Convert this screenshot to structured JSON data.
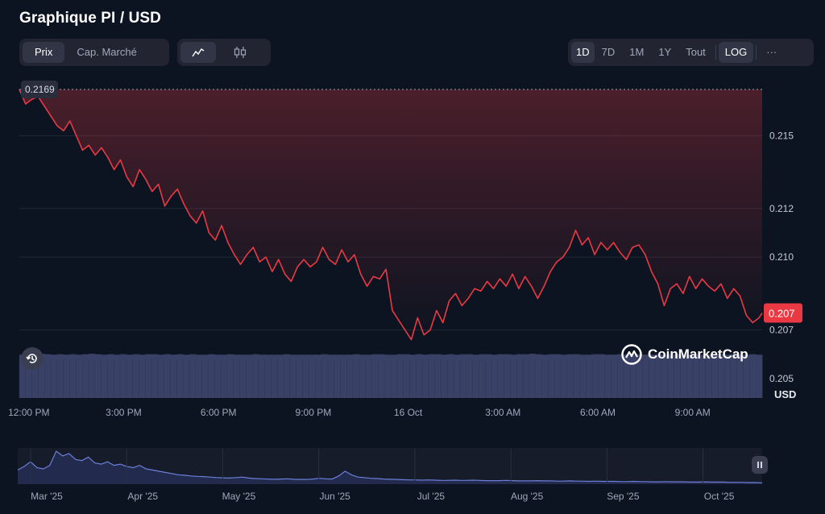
{
  "title": "Graphique PI / USD",
  "view_tabs": [
    {
      "label": "Prix",
      "active": true
    },
    {
      "label": "Cap. Marché",
      "active": false
    }
  ],
  "chart_type_icons": [
    {
      "name": "line-chart-icon",
      "active": true
    },
    {
      "name": "candlestick-icon",
      "active": false
    }
  ],
  "ranges": [
    {
      "label": "1D",
      "active": true
    },
    {
      "label": "7D",
      "active": false
    },
    {
      "label": "1M",
      "active": false
    },
    {
      "label": "1Y",
      "active": false
    },
    {
      "label": "Tout",
      "active": false
    }
  ],
  "log_label": "LOG",
  "more_label": "···",
  "watermark": "CoinMarketCap",
  "currency_label": "USD",
  "history_icon": "history-icon",
  "pause_icon": "pause-icon",
  "colors": {
    "background": "#0d1421",
    "price_line": "#ea3943",
    "volume": "#3a4166",
    "navigator_line": "#6c7fd8"
  },
  "chart_data": [
    {
      "type": "line",
      "title": "Graphique PI / USD",
      "y_unit": "USD",
      "scale": "linear",
      "ylim": [
        0.2042,
        0.2172
      ],
      "yticks": [
        "0.205",
        "0.207",
        "0.210",
        "0.212",
        "0.215"
      ],
      "xticks": [
        "12:00 PM",
        "3:00 PM",
        "6:00 PM",
        "9:00 PM",
        "16 Oct",
        "3:00 AM",
        "6:00 AM",
        "9:00 AM"
      ],
      "x_range_hours": [
        11.7,
        35.2
      ],
      "open_marker": "0.2169",
      "last_price_label": "0.207",
      "grid": true,
      "series": [
        {
          "x": [
            11.7,
            11.9,
            12.1,
            12.3,
            12.5,
            12.7,
            12.9,
            13.1,
            13.3,
            13.5,
            13.7,
            13.9,
            14.1,
            14.3,
            14.5,
            14.7,
            14.9,
            15.1,
            15.3,
            15.5,
            15.7,
            15.9,
            16.1,
            16.3,
            16.5,
            16.7,
            16.9,
            17.1,
            17.3,
            17.5,
            17.7,
            17.9,
            18.1,
            18.3,
            18.5,
            18.7,
            18.9,
            19.1,
            19.3,
            19.5,
            19.7,
            19.9,
            20.1,
            20.3,
            20.5,
            20.7,
            20.9,
            21.1,
            21.3,
            21.5,
            21.7,
            21.9,
            22.1,
            22.3,
            22.5,
            22.7,
            22.9,
            23.1,
            23.3,
            23.5,
            23.7,
            23.9,
            24.1,
            24.3,
            24.5,
            24.7,
            24.9,
            25.1,
            25.3,
            25.5,
            25.7,
            25.9,
            26.1,
            26.3,
            26.5,
            26.7,
            26.9,
            27.1,
            27.3,
            27.5,
            27.7,
            27.9,
            28.1,
            28.3,
            28.5,
            28.7,
            28.9,
            29.1,
            29.3,
            29.5,
            29.7,
            29.9,
            30.1,
            30.3,
            30.5,
            30.7,
            30.9,
            31.1,
            31.3,
            31.5,
            31.7,
            31.9,
            32.1,
            32.3,
            32.5,
            32.7,
            32.9,
            33.1,
            33.3,
            33.5,
            33.7,
            33.9,
            34.1,
            34.3,
            34.5,
            34.7,
            34.9,
            35.1,
            35.2
          ],
          "values": [
            0.2169,
            0.2163,
            0.2165,
            0.2166,
            0.2162,
            0.2158,
            0.2154,
            0.2152,
            0.2156,
            0.215,
            0.2144,
            0.2146,
            0.2142,
            0.2145,
            0.2141,
            0.2136,
            0.214,
            0.2133,
            0.2129,
            0.2136,
            0.2132,
            0.2127,
            0.213,
            0.2121,
            0.2125,
            0.2128,
            0.2122,
            0.2117,
            0.2114,
            0.2119,
            0.211,
            0.2107,
            0.2113,
            0.2106,
            0.2101,
            0.2097,
            0.2101,
            0.2104,
            0.2098,
            0.21,
            0.2094,
            0.2099,
            0.2093,
            0.209,
            0.2096,
            0.2099,
            0.2096,
            0.2098,
            0.2104,
            0.2099,
            0.2097,
            0.2103,
            0.2098,
            0.2101,
            0.2093,
            0.2088,
            0.2092,
            0.2091,
            0.2095,
            0.2078,
            0.2074,
            0.207,
            0.2066,
            0.2075,
            0.2068,
            0.207,
            0.2078,
            0.2073,
            0.2082,
            0.2085,
            0.208,
            0.2083,
            0.2087,
            0.2086,
            0.209,
            0.2087,
            0.2091,
            0.2088,
            0.2093,
            0.2087,
            0.2092,
            0.2088,
            0.2083,
            0.2088,
            0.2094,
            0.2098,
            0.21,
            0.2104,
            0.2111,
            0.2105,
            0.2108,
            0.2101,
            0.2106,
            0.2103,
            0.2106,
            0.2102,
            0.2099,
            0.2104,
            0.2105,
            0.2101,
            0.2094,
            0.2089,
            0.208,
            0.2087,
            0.2089,
            0.2085,
            0.2092,
            0.2087,
            0.2091,
            0.2088,
            0.2086,
            0.2089,
            0.2083,
            0.2087,
            0.2084,
            0.2076,
            0.2073,
            0.2075,
            0.2077
          ]
        }
      ],
      "volume": {
        "type": "bar",
        "relative_heights": [
          0.96,
          0.97,
          0.96,
          0.98,
          0.97,
          0.96,
          0.97,
          0.96,
          0.97,
          0.96,
          0.97,
          0.98,
          0.97,
          0.96,
          0.97,
          0.96,
          0.97,
          0.96,
          0.97,
          0.96,
          0.97,
          0.97,
          0.96,
          0.97,
          0.96,
          0.97,
          0.96,
          0.97,
          0.96,
          0.96,
          0.97,
          0.96,
          0.96,
          0.97,
          0.96,
          0.96,
          0.96,
          0.97,
          0.96,
          0.96,
          0.96,
          0.96,
          0.97,
          0.96,
          0.96,
          0.96,
          0.96,
          0.96,
          0.97,
          0.96,
          0.96,
          0.96,
          0.96,
          0.97,
          0.96,
          0.96,
          0.97,
          0.97,
          0.96,
          0.96,
          0.97,
          0.97,
          0.96,
          0.97,
          0.96,
          0.97,
          0.97,
          0.96,
          0.97,
          0.96,
          0.97,
          0.97,
          0.96,
          0.97,
          0.97,
          0.96,
          0.97,
          0.97,
          0.96,
          0.97,
          0.97,
          0.98,
          0.97,
          0.96,
          0.97,
          0.97,
          0.96,
          0.97,
          0.97,
          0.96,
          0.96,
          0.97,
          0.97,
          0.96,
          0.96,
          0.97,
          0.96,
          0.96,
          0.97,
          0.96,
          0.96,
          0.97,
          0.96,
          0.96,
          0.97,
          0.96,
          0.96,
          0.97,
          0.96,
          0.96,
          0.97,
          0.96,
          0.96,
          0.97,
          0.96,
          0.96,
          0.97,
          0.96
        ]
      }
    },
    {
      "type": "area",
      "role": "navigator",
      "xticks": [
        "Mar '25",
        "Apr '25",
        "May '25",
        "Jun '25",
        "Jul '25",
        "Aug '25",
        "Sep '25",
        "Oct '25"
      ],
      "values": [
        0.6,
        0.75,
        0.95,
        0.7,
        0.65,
        0.8,
        1.4,
        1.2,
        1.3,
        1.05,
        1.0,
        1.15,
        0.9,
        0.85,
        0.95,
        0.8,
        0.85,
        0.75,
        0.7,
        0.8,
        0.65,
        0.6,
        0.55,
        0.5,
        0.45,
        0.4,
        0.38,
        0.35,
        0.33,
        0.32,
        0.3,
        0.28,
        0.27,
        0.26,
        0.28,
        0.3,
        0.26,
        0.24,
        0.23,
        0.22,
        0.21,
        0.22,
        0.23,
        0.21,
        0.2,
        0.2,
        0.22,
        0.25,
        0.23,
        0.22,
        0.35,
        0.55,
        0.4,
        0.3,
        0.28,
        0.25,
        0.24,
        0.22,
        0.21,
        0.2,
        0.19,
        0.18,
        0.18,
        0.17,
        0.18,
        0.17,
        0.16,
        0.16,
        0.17,
        0.16,
        0.16,
        0.17,
        0.16,
        0.15,
        0.15,
        0.15,
        0.16,
        0.15,
        0.14,
        0.14,
        0.14,
        0.15,
        0.14,
        0.14,
        0.13,
        0.13,
        0.14,
        0.13,
        0.13,
        0.12,
        0.13,
        0.12,
        0.12,
        0.12,
        0.11,
        0.11,
        0.12,
        0.11,
        0.11,
        0.1,
        0.1,
        0.11,
        0.1,
        0.1,
        0.1,
        0.09,
        0.09,
        0.1,
        0.09,
        0.09,
        0.09,
        0.08,
        0.08,
        0.08,
        0.07,
        0.07,
        0.06
      ]
    }
  ]
}
